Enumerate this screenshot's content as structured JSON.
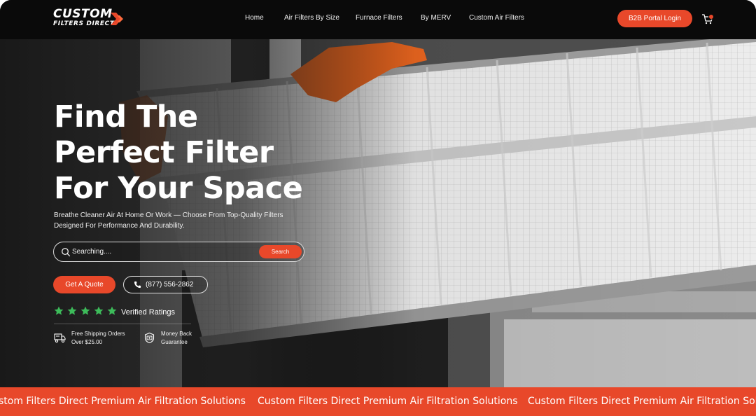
{
  "brand": {
    "logo_line1": "CUSTOM",
    "logo_line2": "FILTERS DIRECT",
    "accent_color": "#e8482a"
  },
  "nav": {
    "items": [
      {
        "label": "Home"
      },
      {
        "label": "Air Filters By Size"
      },
      {
        "label": "Furnace Filters"
      },
      {
        "label": "By MERV"
      },
      {
        "label": "Custom Air Filters"
      }
    ],
    "portal_button": "B2B Portal Login",
    "cart_icon": "cart-icon",
    "cart_count": "0"
  },
  "hero": {
    "headline": [
      "Find The",
      "Perfect Filter",
      "For Your Space"
    ],
    "subtitle": "Breathe Cleaner Air At Home Or Work — Choose From Top-Quality Filters Designed For Performance And Durability.",
    "search": {
      "placeholder": "Searching....",
      "button": "Search",
      "icon": "search-icon"
    },
    "quote_button": "Get A Quote",
    "phone": "(877) 556-2862",
    "rating": {
      "stars": 5,
      "star_color": "#3dbb5a",
      "label": "Verified Ratings"
    },
    "perks": [
      {
        "icon": "truck-icon",
        "line1": "Free Shipping Orders",
        "line2": "Over $25.00"
      },
      {
        "icon": "money-back-icon",
        "line1": "Money Back",
        "line2": "Guarantee"
      }
    ]
  },
  "marquee": {
    "items": [
      "stom Filters Direct Premium Air Filtration Solutions",
      "Custom Filters Direct Premium Air Filtration Solutions",
      "Custom Filters Direct Premium Air Filtration Solu"
    ]
  }
}
